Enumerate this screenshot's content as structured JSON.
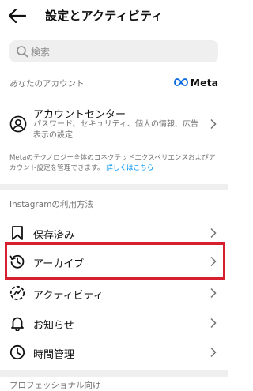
{
  "header": {
    "title": "設定とアクティビティ",
    "back_icon": "arrow-left-icon"
  },
  "search": {
    "placeholder": "検索"
  },
  "account_section": {
    "label": "あなたのアカウント",
    "meta_logo_text": "Meta",
    "accounts_center": {
      "title": "アカウントセンター",
      "subtitle": "パスワード、セキュリティ、個人の情報、広告表示の設定"
    },
    "description": "Metaのテクノロジー全体のコネクテッドエクスペリエンスおよびアカウント設定を管理できます。",
    "learn_more": "詳しくはこちら"
  },
  "usage_section": {
    "label": "Instagramの利用方法",
    "items": [
      {
        "label": "保存済み",
        "icon": "bookmark-icon"
      },
      {
        "label": "アーカイブ",
        "icon": "archive-history-icon"
      },
      {
        "label": "アクティビティ",
        "icon": "activity-icon"
      },
      {
        "label": "お知らせ",
        "icon": "bell-icon"
      },
      {
        "label": "時間管理",
        "icon": "clock-icon"
      }
    ]
  },
  "professional_section": {
    "label": "プロフェッショナル向け"
  },
  "colors": {
    "highlight": "#d6202f",
    "link": "#0095f6",
    "meta_blue": "#0668e1"
  }
}
